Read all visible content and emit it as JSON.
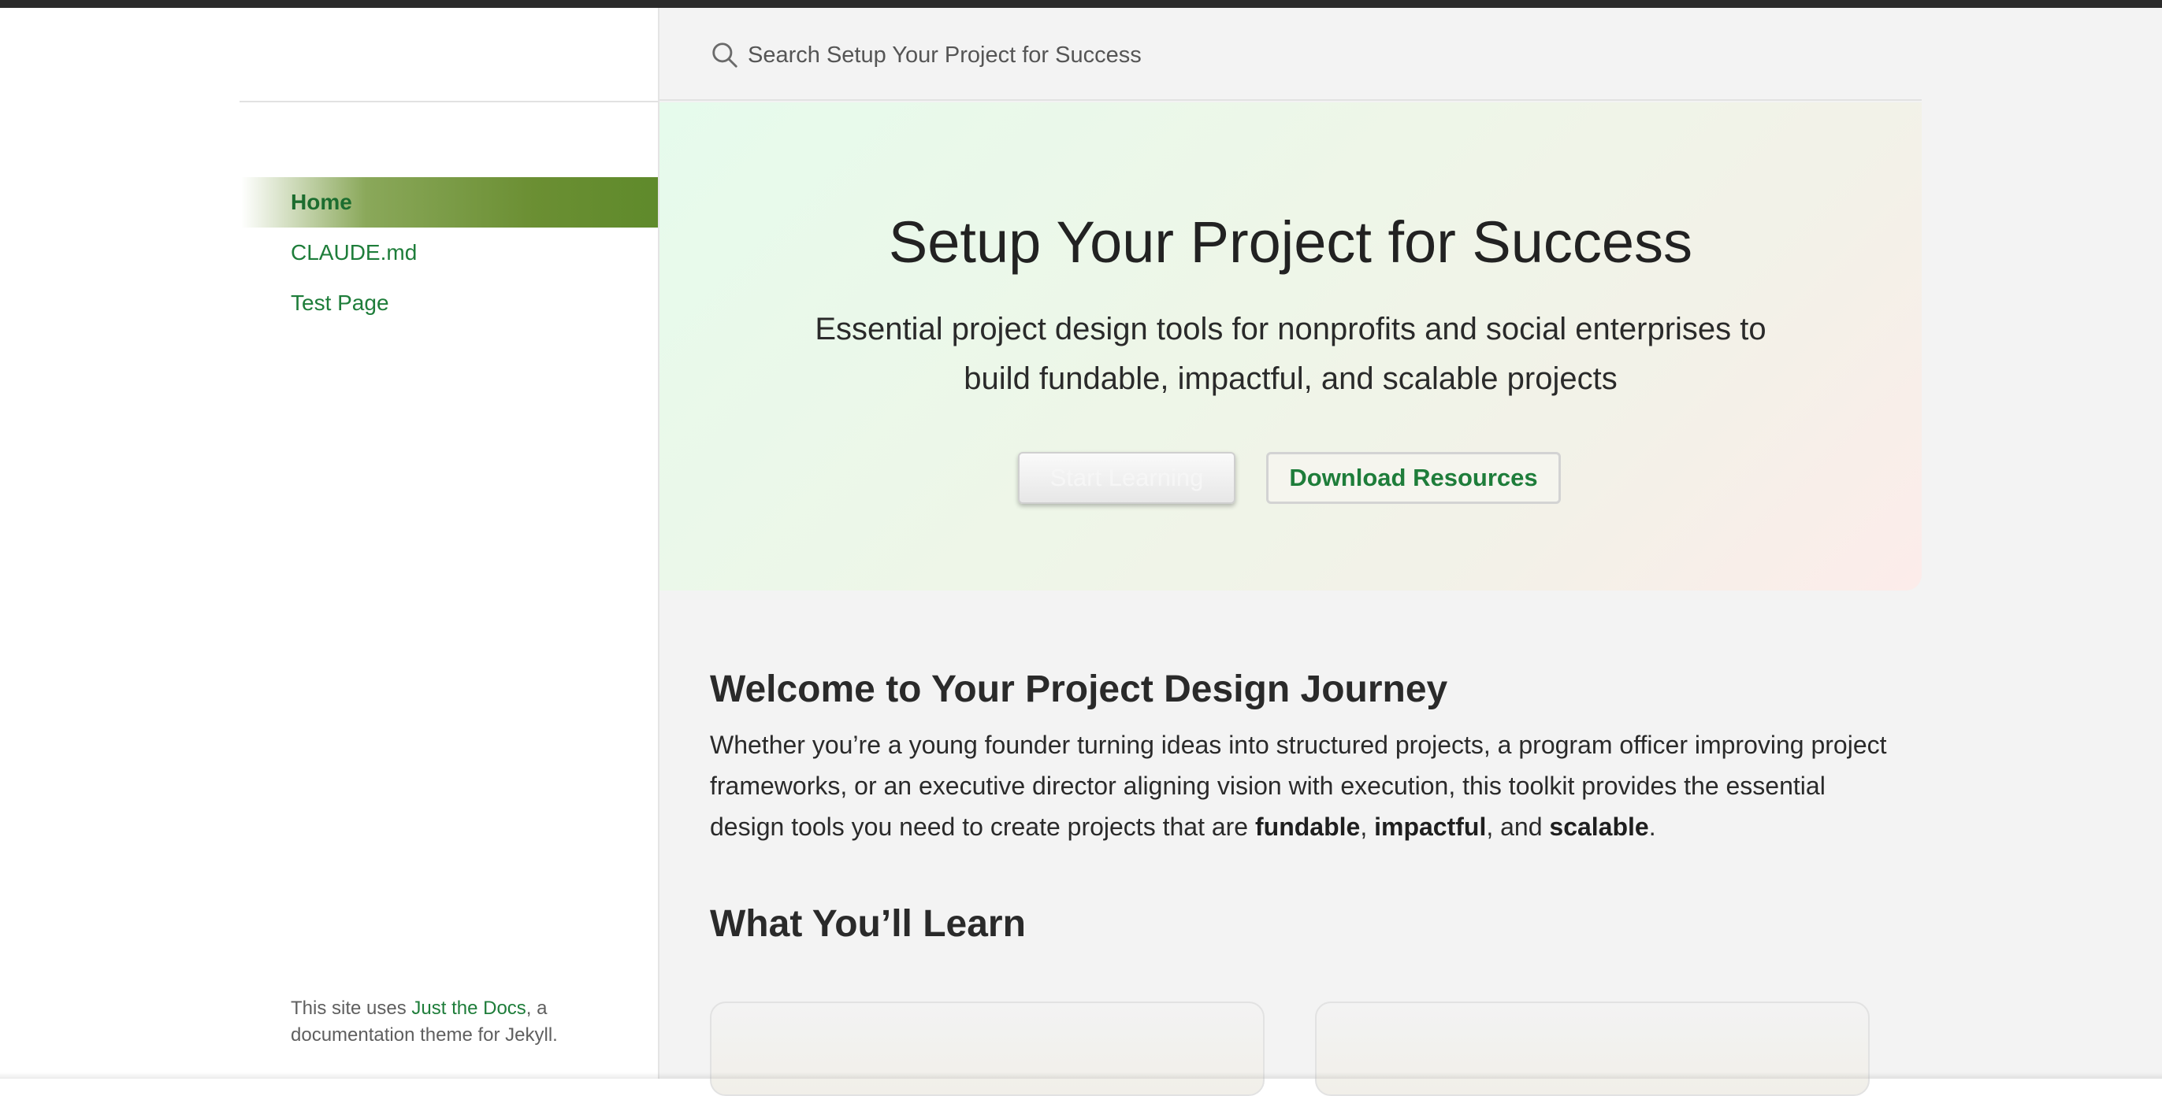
{
  "search": {
    "placeholder": "Search Setup Your Project for Success"
  },
  "sidebar": {
    "items": [
      {
        "label": "Home",
        "active": true
      },
      {
        "label": "CLAUDE.md",
        "active": false
      },
      {
        "label": "Test Page",
        "active": false
      }
    ],
    "footer": {
      "prefix": "This site uses ",
      "link": "Just the Docs",
      "suffix": ", a documentation theme for Jekyll."
    }
  },
  "hero": {
    "title": "Setup Your Project for Success",
    "subtitle": "Essential project design tools for nonprofits and social enterprises to build fundable, impactful, and scalable projects",
    "primary_button": "Start Learning",
    "secondary_button": "Download Resources"
  },
  "welcome": {
    "title": "Welcome to Your Project Design Journey",
    "text_before": "Whether you’re a young founder turning ideas into structured projects, a program officer improving project frameworks, or an executive director aligning vision with execution, this toolkit provides the essential design tools you need to create projects that are ",
    "bold1": "fundable",
    "sep1": ", ",
    "bold2": "impactful",
    "sep2": ", and ",
    "bold3": "scalable",
    "end": "."
  },
  "learn": {
    "title": "What You’ll Learn"
  },
  "colors": {
    "link": "#1e7d3a",
    "active_nav": "#6b8f33",
    "main_bg": "#f3f3f3"
  }
}
